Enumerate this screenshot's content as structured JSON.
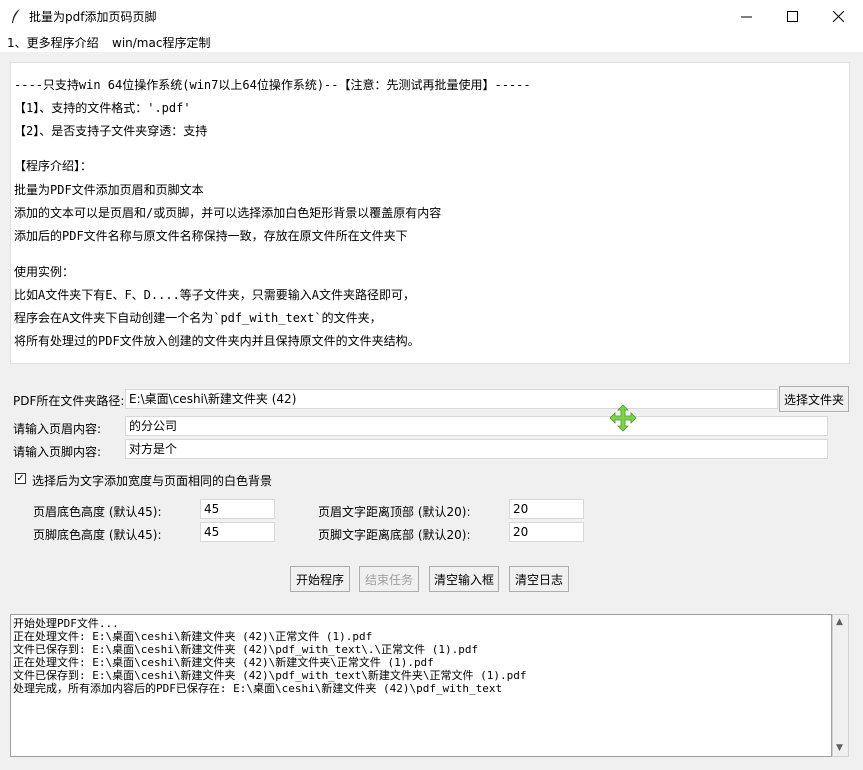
{
  "window": {
    "title": "批量为pdf添加页码页脚"
  },
  "menu": [
    "1、更多程序介绍",
    "win/mac程序定制"
  ],
  "intro": {
    "lines": [
      "----只支持win 64位操作系统(win7以上64位操作系统)--【注意：先测试再批量使用】-----",
      "【1】、支持的文件格式：'.pdf'",
      "【2】、是否支持子文件夹穿透：支持",
      "【程序介绍】：",
      "批量为PDF文件添加页眉和页脚文本",
      "添加的文本可以是页眉和/或页脚，并可以选择添加白色矩形背景以覆盖原有内容",
      "添加后的PDF文件名称与原文件名称保持一致，存放在原文件所在文件夹下",
      "使用实例：",
      "比如A文件夹下有E、F、D....等子文件夹，只需要输入A文件夹路径即可，",
      "程序会在A文件夹下自动创建一个名为`pdf_with_text`的文件夹，",
      "将所有处理过的PDF文件放入创建的文件夹内并且保持原文件的文件夹结构。"
    ]
  },
  "form": {
    "folder_label": "PDF所在文件夹路径:",
    "folder_value": "E:\\桌面\\ceshi\\新建文件夹 (42)",
    "browse_button": "选择文件夹",
    "header_label": "请输入页眉内容:",
    "header_value": "的分公司",
    "footer_label": "请输入页脚内容:",
    "footer_value": "对方是个",
    "checkbox_label": "选择后为文字添加宽度与页面相同的白色背景",
    "checkbox_checked": true,
    "header_bg_label": "页眉底色高度 (默认45):",
    "header_bg_value": "45",
    "footer_bg_label": "页脚底色高度 (默认45):",
    "footer_bg_value": "45",
    "header_dist_label": "页眉文字距离顶部 (默认20):",
    "header_dist_value": "20",
    "footer_dist_label": "页脚文字距离底部 (默认20):",
    "footer_dist_value": "20"
  },
  "buttons": {
    "start": "开始程序",
    "stop": "结束任务",
    "clear_inputs": "清空输入框",
    "clear_log": "清空日志"
  },
  "log": {
    "lines": [
      "开始处理PDF文件...",
      "正在处理文件: E:\\桌面\\ceshi\\新建文件夹 (42)\\正常文件 (1).pdf",
      "文件已保存到: E:\\桌面\\ceshi\\新建文件夹 (42)\\pdf_with_text\\.\\正常文件 (1).pdf",
      "正在处理文件: E:\\桌面\\ceshi\\新建文件夹 (42)\\新建文件夹\\正常文件 (1).pdf",
      "文件已保存到: E:\\桌面\\ceshi\\新建文件夹 (42)\\pdf_with_text\\新建文件夹\\正常文件 (1).pdf",
      "处理完成，所有添加内容后的PDF已保存在: E:\\桌面\\ceshi\\新建文件夹 (42)\\pdf_with_text"
    ]
  }
}
